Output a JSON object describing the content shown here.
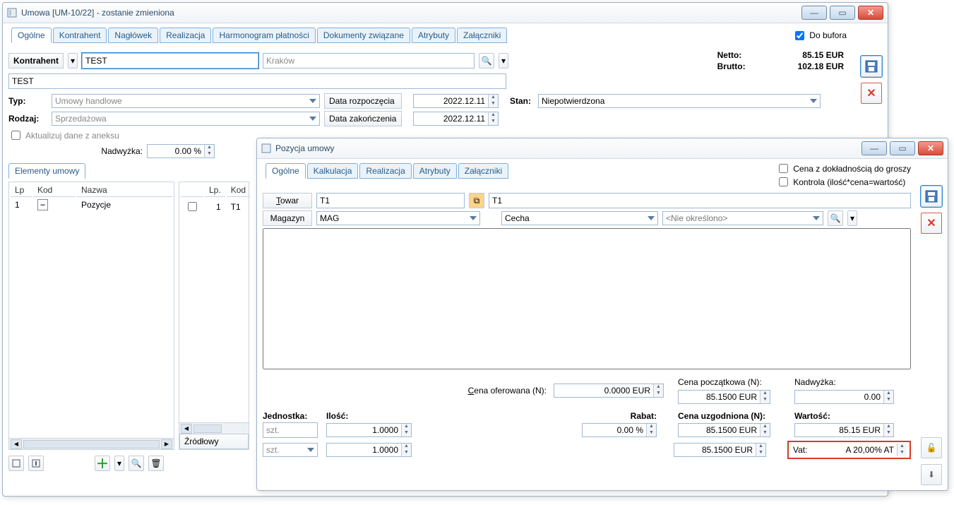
{
  "main": {
    "title": "Umowa [UM-10/22] - zostanie zmieniona",
    "tabs": [
      "Ogólne",
      "Kontrahent",
      "Nagłówek",
      "Realizacja",
      "Harmonogram płatności",
      "Dokumenty związane",
      "Atrybuty",
      "Załączniki"
    ],
    "do_bufora": "Do bufora",
    "kontrahent_btn": "Kontrahent",
    "kontrahent_val": "TEST",
    "kontrahent_city": "Kraków",
    "kontrahent_name": "TEST",
    "netto_label": "Netto:",
    "netto_val": "85.15  EUR",
    "brutto_label": "Brutto:",
    "brutto_val": "102.18  EUR",
    "typ_label": "Typ:",
    "typ_val": "Umowy handlowe",
    "rodzaj_label": "Rodzaj:",
    "rodzaj_val": "Sprzedażowa",
    "aktualizuj": "Aktualizuj dane z aneksu",
    "data_rozp_btn": "Data rozpoczęcia",
    "data_rozp_val": "2022.12.11",
    "data_zak_btn": "Data zakończenia",
    "data_zak_val": "2022.12.11",
    "stan_label": "Stan:",
    "stan_val": "Niepotwierdzona",
    "nadwyzka_label": "Nadwyżka:",
    "nadwyzka_val": "0.00 %",
    "elementy_umowy": "Elementy umowy",
    "tree_headers": {
      "lp": "Lp",
      "kod": "Kod",
      "nazwa": "Nazwa"
    },
    "tree_row": {
      "lp": "1",
      "nazwa": "Pozycje"
    },
    "grid_headers": {
      "lp": "Lp.",
      "kod": "Kod"
    },
    "grid_row": {
      "lp": "1",
      "kod": "T1"
    },
    "zrodlowy": "Źródłowy"
  },
  "dlg": {
    "title": "Pozycja umowy",
    "tabs": [
      "Ogólne",
      "Kalkulacja",
      "Realizacja",
      "Atrybuty",
      "Załączniki"
    ],
    "cena_dokl": "Cena z dokładnością do groszy",
    "kontrola": "Kontrola (ilość*cena=wartość)",
    "towar_btn": "Towar",
    "towar_val": "T1",
    "towar_name": "T1",
    "magazyn_btn": "Magazyn",
    "magazyn_val": "MAG",
    "cecha_val": "Cecha",
    "nieokreslono": "<Nie określono>",
    "cena_ofer_label": "Cena oferowana (N):",
    "cena_ofer_val": "0.0000 EUR",
    "cena_pocz_label": "Cena początkowa (N):",
    "cena_pocz_val": "85.1500 EUR",
    "nadwyzka_label": "Nadwyżka:",
    "nadwyzka_val": "0.00",
    "jednostka_label": "Jednostka:",
    "ilosc_label": "Ilość:",
    "rabat_label": "Rabat:",
    "rabat_val": "0.00 %",
    "cena_uzg_label": "Cena uzgodniona (N):",
    "cena_uzg_val": "85.1500 EUR",
    "cena_uzg_val2": "85.1500 EUR",
    "wartosc_label": "Wartość:",
    "wartosc_val": "85.15 EUR",
    "jedn_val": "szt.",
    "ilosc_val1": "1.0000",
    "ilosc_val2": "1.0000",
    "vat_label": "Vat:",
    "vat_val": "A 20,00% AT"
  }
}
